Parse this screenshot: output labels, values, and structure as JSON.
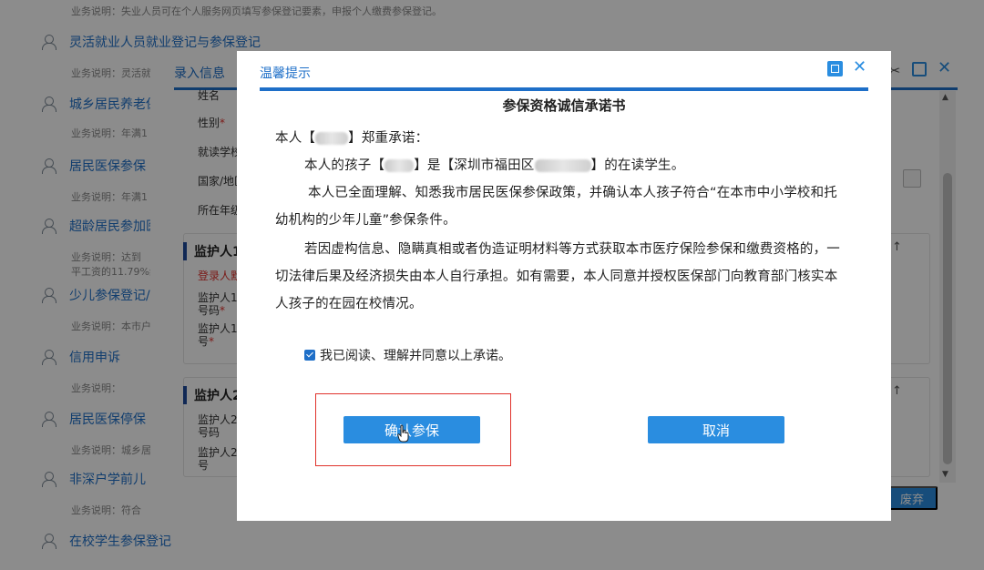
{
  "background": {
    "services": [
      {
        "title": "",
        "desc": "业务说明：失业人员可在个人服务网页填写参保登记要素，申报个人缴费参保登记。"
      },
      {
        "title": "灵活就业人员就业登记与参保登记",
        "desc": "业务说明：灵活就"
      },
      {
        "title": "城乡居民养老保",
        "desc": "业务说明：年满1"
      },
      {
        "title": "居民医保参保",
        "desc": "业务说明：年满1"
      },
      {
        "title": "超龄居民参加医",
        "desc": "业务说明：达到"
      },
      {
        "title": "",
        "desc": "平工资的11.79%缴"
      },
      {
        "title": "少儿参保登记/",
        "desc": "业务说明：本市户"
      },
      {
        "title": "信用申诉",
        "desc": "业务说明："
      },
      {
        "title": "居民医保停保",
        "desc": "业务说明：城乡居"
      },
      {
        "title": "非深户学前儿",
        "desc": "业务说明：符合"
      },
      {
        "title": "在校学生参保登记",
        "desc": ""
      }
    ]
  },
  "entry_dialog": {
    "title": "录入信息",
    "fields": [
      {
        "label": "姓名",
        "required": false
      },
      {
        "label": "性别",
        "required": true
      },
      {
        "label": "就读学校",
        "required": false
      },
      {
        "label": "国家/地区",
        "required": false
      },
      {
        "label": "所在年级",
        "required": false
      }
    ],
    "guardian1": {
      "title": "监护人1",
      "warning": "登录人默",
      "field_a_line1": "监护人1",
      "field_a_line2": "号码",
      "field_b_line1": "监护人1",
      "field_b_line2": "号"
    },
    "guardian2": {
      "title": "监护人2",
      "field_a_line1": "监护人2",
      "field_a_line2": "号码",
      "field_b_line1": "监护人2",
      "field_b_line2": "号"
    },
    "abandon_label": "废弃"
  },
  "notice_dialog": {
    "title": "温馨提示",
    "doc_title": "参保资格诚信承诺书",
    "line1_a": "本人【",
    "line1_b": "】郑重承诺：",
    "line2_a": "本人的孩子【",
    "line2_b": "】是【深圳市福田区",
    "line2_c": "】的在读学生。",
    "line3": "本人已全面理解、知悉我市居民医保参保政策，并确认本人孩子符合“在本市中小学校和托",
    "line4": "幼机构的少年儿童”参保条件。",
    "line5": "若因虚构信息、隐瞒真相或者伪造证明材料等方式获取本市医疗保险参保和缴费资格的，一",
    "line6": "切法律后果及经济损失由本人自行承担。如有需要，本人同意并授权医保部门向教育部门核实本",
    "line7": "人孩子的在园在校情况。",
    "agree_text": "我已阅读、理解并同意以上承诺。",
    "agree_checked": true,
    "confirm_label": "确认参保",
    "cancel_label": "取消",
    "accent": "#2a8de0",
    "highlight": "#e0322c"
  }
}
